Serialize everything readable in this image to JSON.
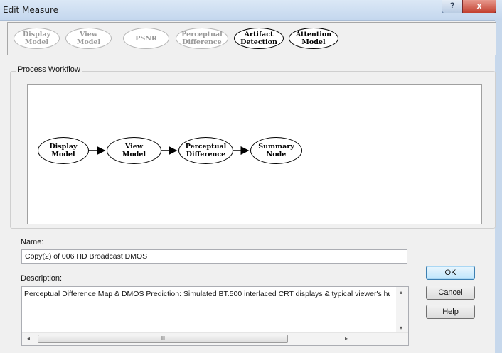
{
  "window": {
    "title": "Edit Measure",
    "help_label": "?",
    "close_label": "x"
  },
  "toolbar": {
    "items": [
      {
        "label": "Display\nModel",
        "active": false
      },
      {
        "label": "View\nModel",
        "active": false
      },
      {
        "label": "PSNR",
        "active": false
      },
      {
        "label": "Perceptual\nDifference",
        "active": false
      },
      {
        "label": "Artifact\nDetection",
        "active": true
      },
      {
        "label": "Attention\nModel",
        "active": true
      }
    ]
  },
  "workflow": {
    "group_label": "Process Workflow",
    "nodes": [
      {
        "label": "Display\nModel"
      },
      {
        "label": "View\nModel"
      },
      {
        "label": "Perceptual\nDifference"
      },
      {
        "label": "Summary\nNode"
      }
    ]
  },
  "name": {
    "label": "Name:",
    "value": "Copy(2) of 006 HD Broadcast DMOS"
  },
  "description": {
    "label": "Description:",
    "value": "Perceptual Difference Map & DMOS  Prediction:  Simulated BT.500 interlaced CRT displays & typical viewer's humar"
  },
  "buttons": {
    "ok": "OK",
    "cancel": "Cancel",
    "help": "Help"
  },
  "scroll": {
    "thumb_grip": "III",
    "left_arrow": "◂",
    "right_arrow": "▸",
    "up_arrow": "▴",
    "down_arrow": "▾"
  }
}
